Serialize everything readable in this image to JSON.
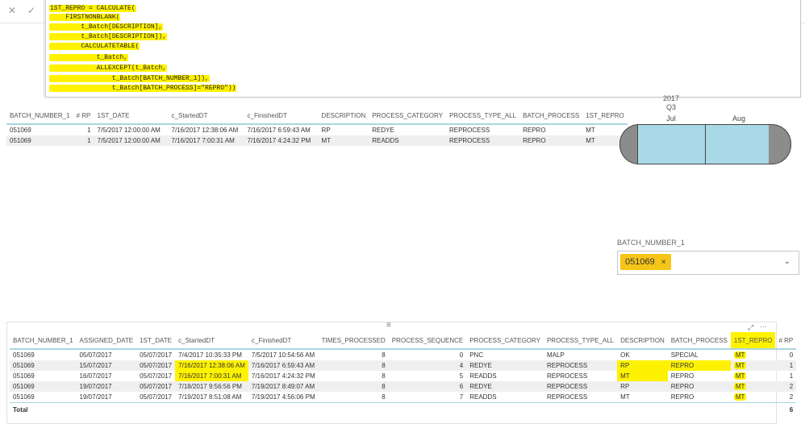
{
  "formula_bar": {
    "cancel_glyph": "✕",
    "commit_glyph": "✓",
    "lines": [
      "1ST_REPRO = CALCULATE(",
      "    FIRSTNONBLANK(",
      "        t_Batch[DESCRIPTION],",
      "        t_Batch[DESCRIPTION]),",
      "        CALCULATETABLE(",
      "            t_Batch,",
      "            ALLEXCEPT(t_Batch,",
      "                t_Batch[BATCH_NUMBER_1]),",
      "                t_Batch[BATCH_PROCESS]=\"REPRO\"))"
    ]
  },
  "top_table": {
    "columns": [
      "BATCH_NUMBER_1",
      "# RP",
      "1ST_DATE",
      "c_StartedDT",
      "c_FinishedDT",
      "DESCRIPTION",
      "PROCESS_CATEGORY",
      "PROCESS_TYPE_ALL",
      "BATCH_PROCESS",
      "1ST_REPRO"
    ],
    "rows": [
      [
        "051069",
        "1",
        "7/5/2017 12:00:00 AM",
        "7/16/2017 12:38:06 AM",
        "7/16/2017 6:59:43 AM",
        "RP",
        "REDYE",
        "REPROCESS",
        "REPRO",
        "MT"
      ],
      [
        "051069",
        "1",
        "7/5/2017 12:00:00 AM",
        "7/16/2017 7:00:31 AM",
        "7/16/2017 4:24:32 PM",
        "MT",
        "READDS",
        "REPROCESS",
        "REPRO",
        "MT"
      ]
    ]
  },
  "timeline": {
    "year": "2017",
    "quarter": "Q3",
    "months": [
      "Jul",
      "Aug"
    ],
    "bar_color": "#a9d8e6",
    "cap_color": "#8c8c8c"
  },
  "slicer": {
    "title": "BATCH_NUMBER_1",
    "selected": "051069",
    "remove_glyph": "×",
    "chevron": "⌄",
    "chip_color": "#f5c518"
  },
  "bottom_table": {
    "columns": [
      "BATCH_NUMBER_1",
      "ASSIGNED_DATE",
      "1ST_DATE",
      "c_StartedDT",
      "c_FinishedDT",
      "TIMES_PROCESSED",
      "PROCESS_SEQUENCE",
      "PROCESS_CATEGORY",
      "PROCESS_TYPE_ALL",
      "DESCRIPTION",
      "BATCH_PROCESS",
      "1ST_REPRO",
      "# RP"
    ],
    "rows": [
      [
        "051069",
        "05/07/2017",
        "05/07/2017",
        "7/4/2017 10:35:33 PM",
        "7/5/2017 10:54:56 AM",
        "8",
        "0",
        "PNC",
        "MALP",
        "OK",
        "SPECIAL",
        "MT",
        "0"
      ],
      [
        "051069",
        "15/07/2017",
        "05/07/2017",
        "7/16/2017 12:38:06 AM",
        "7/16/2017 6:59:43 AM",
        "8",
        "4",
        "REDYE",
        "REPROCESS",
        "RP",
        "REPRO",
        "MT",
        "1"
      ],
      [
        "051069",
        "16/07/2017",
        "05/07/2017",
        "7/16/2017 7:00:31 AM",
        "7/16/2017 4:24:32 PM",
        "8",
        "5",
        "READDS",
        "REPROCESS",
        "MT",
        "REPRO",
        "MT",
        "1"
      ],
      [
        "051069",
        "19/07/2017",
        "05/07/2017",
        "7/18/2017 9:56:56 PM",
        "7/19/2017 8:49:07 AM",
        "8",
        "6",
        "REDYE",
        "REPROCESS",
        "RP",
        "REPRO",
        "MT",
        "2"
      ],
      [
        "051069",
        "19/07/2017",
        "05/07/2017",
        "7/19/2017 8:51:08 AM",
        "7/19/2017 4:56:06 PM",
        "8",
        "7",
        "READDS",
        "REPROCESS",
        "MT",
        "REPRO",
        "MT",
        "2"
      ]
    ],
    "total_label": "Total",
    "total_rp": "6",
    "drag_glyph": "≡",
    "focus_glyph": "⤢",
    "more_glyph": "···"
  },
  "highlight_color": "#fff200"
}
